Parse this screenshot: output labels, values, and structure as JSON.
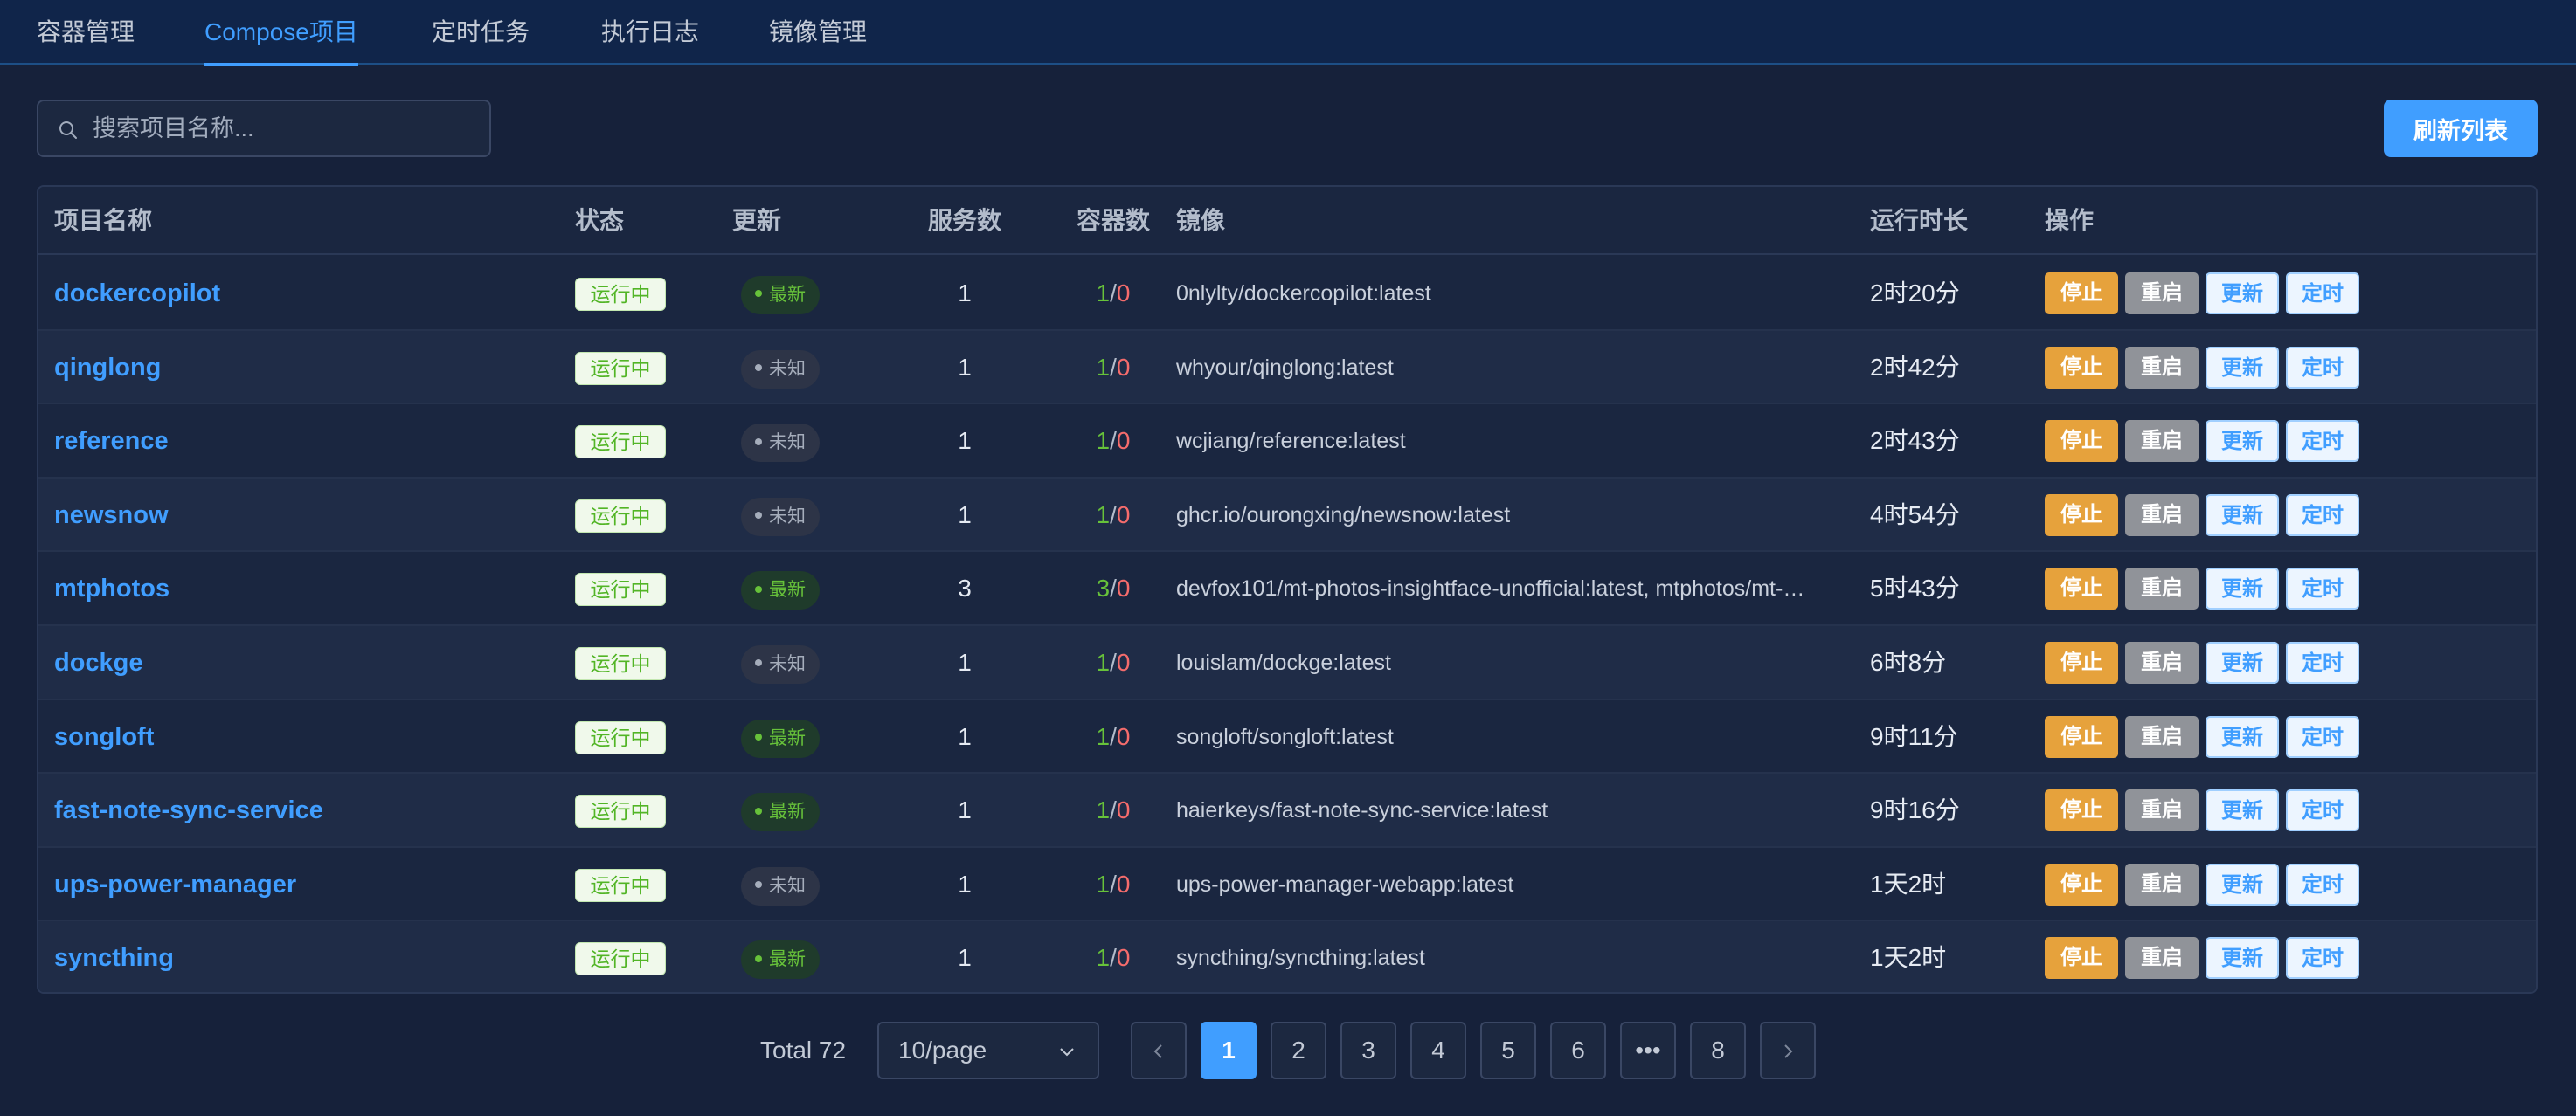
{
  "tabs": [
    {
      "label": "容器管理",
      "active": false
    },
    {
      "label": "Compose项目",
      "active": true
    },
    {
      "label": "定时任务",
      "active": false
    },
    {
      "label": "执行日志",
      "active": false
    },
    {
      "label": "镜像管理",
      "active": false
    }
  ],
  "search": {
    "placeholder": "搜索项目名称...",
    "value": ""
  },
  "refresh_label": "刷新列表",
  "table": {
    "headers": [
      "项目名称",
      "状态",
      "更新",
      "服务数",
      "容器数",
      "镜像",
      "运行时长",
      "操作"
    ],
    "rows": [
      {
        "name": "dockercopilot",
        "status": "运行中",
        "update": "最新",
        "update_state": "latest",
        "services": "1",
        "c_up": "1",
        "c_down": "0",
        "image": "0nlylty/dockercopilot:latest",
        "uptime": "2时20分"
      },
      {
        "name": "qinglong",
        "status": "运行中",
        "update": "未知",
        "update_state": "unknown",
        "services": "1",
        "c_up": "1",
        "c_down": "0",
        "image": "whyour/qinglong:latest",
        "uptime": "2时42分"
      },
      {
        "name": "reference",
        "status": "运行中",
        "update": "未知",
        "update_state": "unknown",
        "services": "1",
        "c_up": "1",
        "c_down": "0",
        "image": "wcjiang/reference:latest",
        "uptime": "2时43分"
      },
      {
        "name": "newsnow",
        "status": "运行中",
        "update": "未知",
        "update_state": "unknown",
        "services": "1",
        "c_up": "1",
        "c_down": "0",
        "image": "ghcr.io/ourongxing/newsnow:latest",
        "uptime": "4时54分"
      },
      {
        "name": "mtphotos",
        "status": "运行中",
        "update": "最新",
        "update_state": "latest",
        "services": "3",
        "c_up": "3",
        "c_down": "0",
        "image": "devfox101/mt-photos-insightface-unofficial:latest, mtphotos/mt-…",
        "uptime": "5时43分"
      },
      {
        "name": "dockge",
        "status": "运行中",
        "update": "未知",
        "update_state": "unknown",
        "services": "1",
        "c_up": "1",
        "c_down": "0",
        "image": "louislam/dockge:latest",
        "uptime": "6时8分"
      },
      {
        "name": "songloft",
        "status": "运行中",
        "update": "最新",
        "update_state": "latest",
        "services": "1",
        "c_up": "1",
        "c_down": "0",
        "image": "songloft/songloft:latest",
        "uptime": "9时11分"
      },
      {
        "name": "fast-note-sync-service",
        "status": "运行中",
        "update": "最新",
        "update_state": "latest",
        "services": "1",
        "c_up": "1",
        "c_down": "0",
        "image": "haierkeys/fast-note-sync-service:latest",
        "uptime": "9时16分"
      },
      {
        "name": "ups-power-manager",
        "status": "运行中",
        "update": "未知",
        "update_state": "unknown",
        "services": "1",
        "c_up": "1",
        "c_down": "0",
        "image": "ups-power-manager-webapp:latest",
        "uptime": "1天2时"
      },
      {
        "name": "syncthing",
        "status": "运行中",
        "update": "最新",
        "update_state": "latest",
        "services": "1",
        "c_up": "1",
        "c_down": "0",
        "image": "syncthing/syncthing:latest",
        "uptime": "1天2时"
      }
    ],
    "actions": {
      "stop": "停止",
      "restart": "重启",
      "update": "更新",
      "schedule": "定时"
    }
  },
  "pagination": {
    "total_label": "Total 72",
    "page_size": "10/page",
    "pages": [
      "1",
      "2",
      "3",
      "4",
      "5",
      "6",
      "•••",
      "8"
    ],
    "current_page": "1"
  },
  "colors": {
    "accent": "#409eff",
    "running_text": "#52b526",
    "latest_dot": "#67c23a",
    "stop_button": "#e6a23c",
    "restart_button": "#909399",
    "down_count": "#f56c6c"
  }
}
